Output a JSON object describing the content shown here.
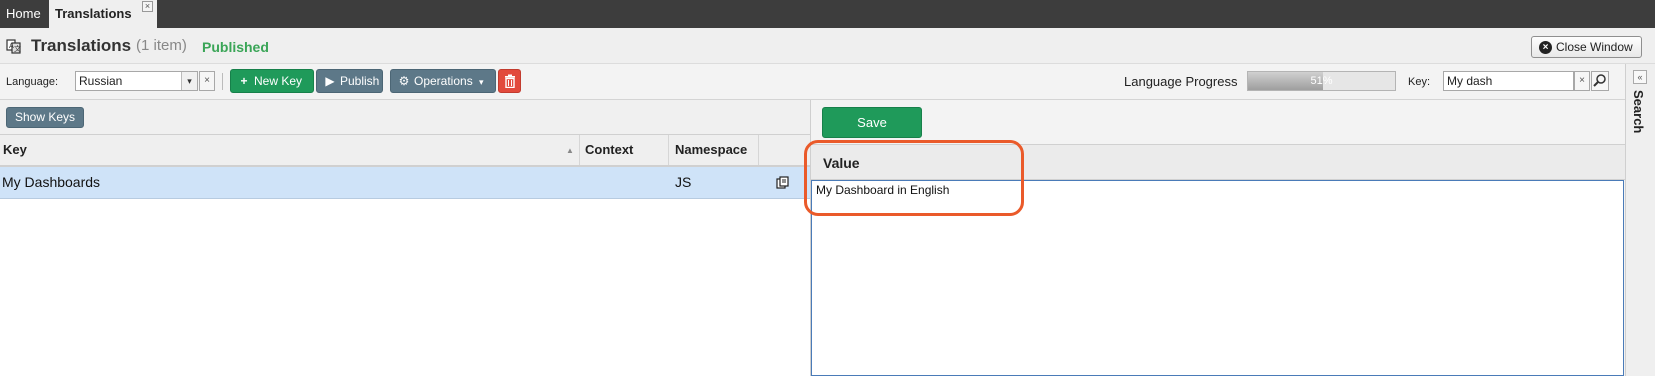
{
  "tabs": [
    {
      "label": "Home"
    },
    {
      "label": "Translations"
    }
  ],
  "tab_close_glyph": "×",
  "header": {
    "title": "Translations",
    "item_count": "(1 item)",
    "status": "Published",
    "status_color": "#3aa557",
    "close_window_label": "Close Window",
    "close_icon_glyph": "×"
  },
  "toolbar": {
    "language_label": "Language:",
    "language_value": "Russian",
    "dropdown_glyph": "▾",
    "clear_glyph": "×",
    "new_key_label": "New Key",
    "new_key_glyph": "+",
    "publish_label": "Publish",
    "publish_glyph": "▶",
    "operations_label": "Operations",
    "operations_glyph": "⚙",
    "operations_caret": "▾",
    "delete_glyph": "🗑",
    "progress_label": "Language Progress",
    "progress_text": "51%",
    "progress_value": 0.51,
    "key_label": "Key:",
    "key_value": "My dash"
  },
  "grid": {
    "show_keys_label": "Show Keys",
    "columns": [
      {
        "label": "Key"
      },
      {
        "label": "Context"
      },
      {
        "label": "Namespace"
      },
      {
        "label": ""
      }
    ],
    "sort_glyph": "▲",
    "rows": [
      {
        "key": "My Dashboards",
        "context": "",
        "namespace": "JS"
      }
    ]
  },
  "editor": {
    "save_label": "Save",
    "value_title": "Value",
    "value_text": "My Dashboard in English"
  },
  "sidebar": {
    "label": "Search",
    "collapse_glyph": "«"
  },
  "colors": {
    "accent_green": "#1f9a5a",
    "slate_button": "#5d7888",
    "delete_red": "#e24a3c",
    "selected_row": "#cfe3f8",
    "highlight_orange": "#ea5a2a"
  }
}
